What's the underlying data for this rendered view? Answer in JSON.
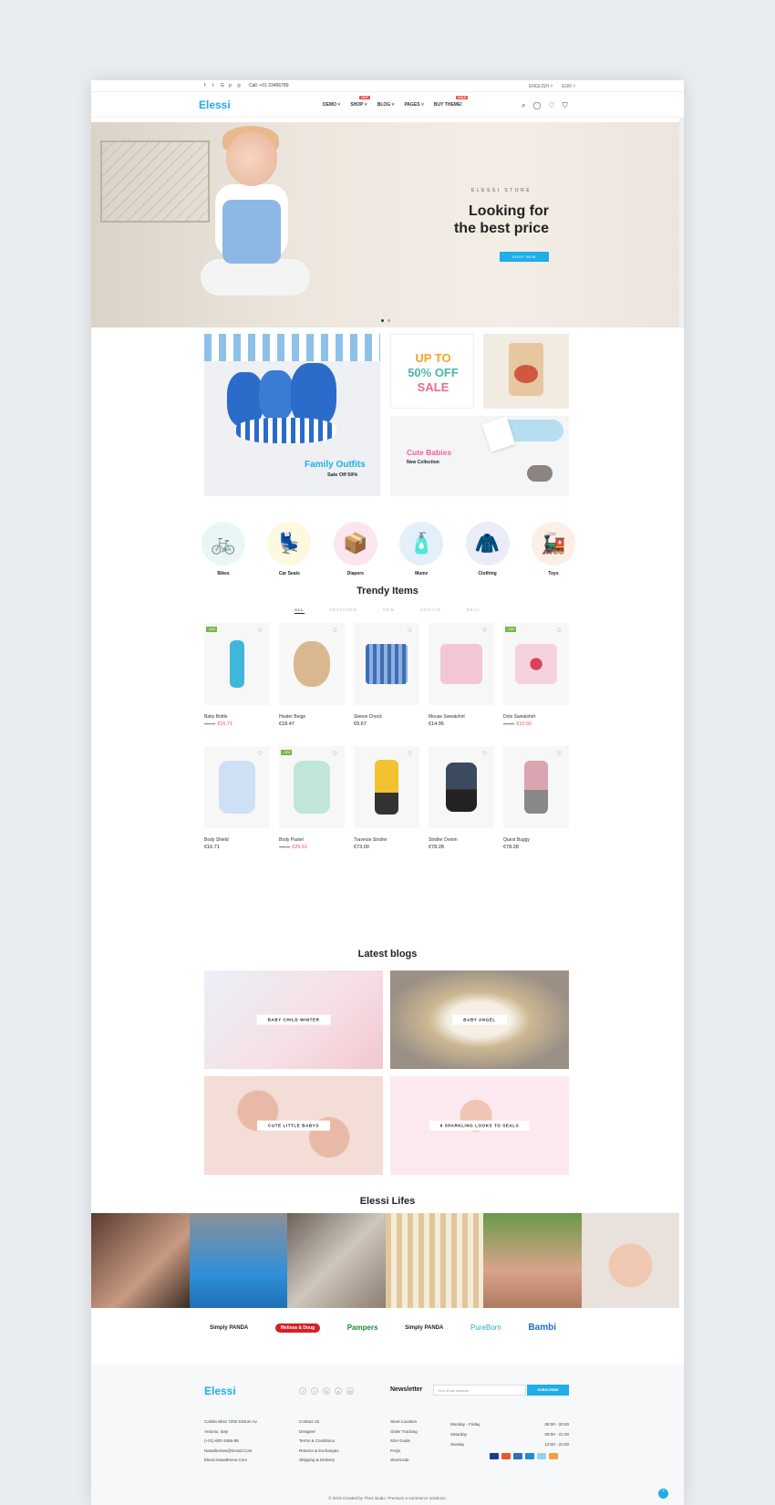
{
  "topbar": {
    "phone": "Call: +01 23456789",
    "language": "ENGLISH ˅",
    "currency": "EUR ˅"
  },
  "header": {
    "logo": "Elessi",
    "nav": [
      {
        "label": "DEMO ˅",
        "badge": ""
      },
      {
        "label": "SHOP ˅",
        "badge": "HOT"
      },
      {
        "label": "BLOG ˅",
        "badge": ""
      },
      {
        "label": "PAGES ˅",
        "badge": ""
      },
      {
        "label": "BUY THEME!",
        "badge": "SALE"
      }
    ]
  },
  "hero": {
    "kicker": "ELESSI STORE",
    "title_line1": "Looking for",
    "title_line2": "the best price",
    "button": "SHOP NOW"
  },
  "banners": {
    "family_title": "Family Outfits",
    "family_sub": "Sale Off 50%",
    "sale_line1": "UP TO",
    "sale_line2": "50% OFF",
    "sale_line3": "SALE",
    "babies_title": "Cute Babies",
    "babies_sub": "New Collection"
  },
  "categories": [
    {
      "label": "Bikes",
      "icon": "bike-icon",
      "color": "#e9f6f5"
    },
    {
      "label": "Car Seats",
      "icon": "car-seat-icon",
      "color": "#fdf8e0"
    },
    {
      "label": "Diapers",
      "icon": "diaper-icon",
      "color": "#fbe6f0"
    },
    {
      "label": "Mumz",
      "icon": "lotion-icon",
      "color": "#e3f0fb"
    },
    {
      "label": "Clothing",
      "icon": "clothing-icon",
      "color": "#ecebf8"
    },
    {
      "label": "Toys",
      "icon": "train-toy-icon",
      "color": "#fdeee6"
    }
  ],
  "trendy": {
    "title": "Trendy Items",
    "tabs": [
      "ALL",
      "FEATURED",
      "NEW",
      "ONSALE",
      "DEAL"
    ],
    "products": [
      {
        "name": "Baby Bottle",
        "old": "€20.00",
        "price": "€16.71",
        "tag": "-16%"
      },
      {
        "name": "Heater Beige",
        "old": "",
        "price": "€18.47",
        "tag": ""
      },
      {
        "name": "Sleeve Check",
        "old": "",
        "price": "€9.67",
        "tag": ""
      },
      {
        "name": "Mouse Sweatshirt",
        "old": "",
        "price": "€14.95",
        "tag": ""
      },
      {
        "name": "Dots Sweatshirt",
        "old": "€15.89",
        "price": "€10.55",
        "tag": "-34%"
      },
      {
        "name": "Body Shield",
        "old": "",
        "price": "€16.71",
        "tag": ""
      },
      {
        "name": "Body Pastel",
        "old": "€30.16",
        "price": "€25.51",
        "tag": "-15%"
      },
      {
        "name": "Traverze Stroller",
        "old": "",
        "price": "€73.00",
        "tag": ""
      },
      {
        "name": "Stroller Denim",
        "old": "",
        "price": "€78.28",
        "tag": ""
      },
      {
        "name": "Quest Buggy",
        "old": "",
        "price": "€78.28",
        "tag": ""
      }
    ]
  },
  "blogs": {
    "title": "Latest blogs",
    "items": [
      "BABY CHILD WINTER",
      "BABY ANGEL",
      "CUTE LITTLE BABYS",
      "6 SPARKLING LOOKS TO SEALS"
    ]
  },
  "lifes": {
    "title": "Elessi Lifes"
  },
  "brands": [
    "Simply PANDA",
    "Melissa & Doug",
    "Pampers",
    "Simply PANDA",
    "PureBorn",
    "Bambi"
  ],
  "footer": {
    "logo": "Elessi",
    "address": [
      "Calista Wise 7292 Dictum Av.",
      "Antonio, Italy",
      "(+01)-800-3456-88",
      "Nasathemes@Gmail.Com",
      "Elessi.Nasatheme.Com"
    ],
    "links1": [
      "Contact Us",
      "Designer",
      "Terms & Conditions",
      "Returns & Exchanges",
      "Shipping & Delivery"
    ],
    "links2": [
      "Store Location",
      "Order Tracking",
      "Size Guide",
      "FAQs",
      "Shortcode"
    ],
    "newsletter_title": "Newsletter",
    "email_placeholder": "Your email address",
    "subscribe": "SUBSCRIBE",
    "hours": [
      {
        "day": "Monday - Friday",
        "time": "08:00 - 20:00"
      },
      {
        "day": "Saturday",
        "time": "09:00 - 21:00"
      },
      {
        "day": "Sunday",
        "time": "13:00 - 22:00"
      }
    ],
    "copyright": "© 2019 Created by The4 studio. Premium e-commerce solutions."
  },
  "colors": {
    "accent": "#1faee8",
    "sale": "#f04e4e",
    "tag": "#7ab648"
  }
}
